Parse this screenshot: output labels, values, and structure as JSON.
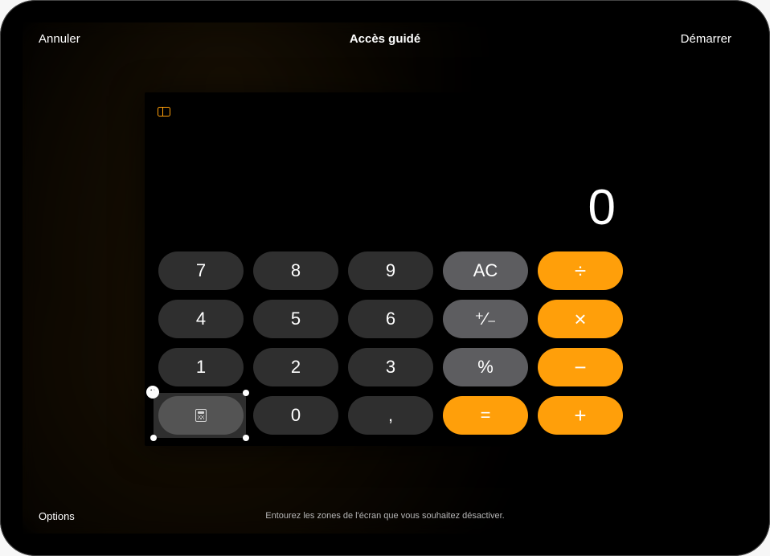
{
  "header": {
    "cancel": "Annuler",
    "title": "Accès guidé",
    "start": "Démarrer"
  },
  "footer": {
    "options": "Options",
    "hint": "Entourez les zones de l'écran que vous souhaitez désactiver."
  },
  "calculator": {
    "display": "0",
    "rows": [
      [
        {
          "id": "seven",
          "label": "7",
          "kind": "num"
        },
        {
          "id": "eight",
          "label": "8",
          "kind": "num"
        },
        {
          "id": "nine",
          "label": "9",
          "kind": "num"
        },
        {
          "id": "ac",
          "label": "AC",
          "kind": "fn"
        },
        {
          "id": "divide",
          "label": "÷",
          "kind": "op"
        }
      ],
      [
        {
          "id": "four",
          "label": "4",
          "kind": "num"
        },
        {
          "id": "five",
          "label": "5",
          "kind": "num"
        },
        {
          "id": "six",
          "label": "6",
          "kind": "num"
        },
        {
          "id": "sign",
          "label": "⁺∕₋",
          "kind": "fn"
        },
        {
          "id": "multiply",
          "label": "×",
          "kind": "op"
        }
      ],
      [
        {
          "id": "one",
          "label": "1",
          "kind": "num"
        },
        {
          "id": "two",
          "label": "2",
          "kind": "num"
        },
        {
          "id": "three",
          "label": "3",
          "kind": "num"
        },
        {
          "id": "percent",
          "label": "%",
          "kind": "fn"
        },
        {
          "id": "minus",
          "label": "−",
          "kind": "op"
        }
      ],
      [
        {
          "id": "mode",
          "label": "",
          "kind": "num",
          "icon": "calculator-icon"
        },
        {
          "id": "zero",
          "label": "0",
          "kind": "num"
        },
        {
          "id": "decimal",
          "label": ",",
          "kind": "num"
        },
        {
          "id": "equals",
          "label": "=",
          "kind": "eq"
        },
        {
          "id": "plus",
          "label": "+",
          "kind": "op"
        }
      ]
    ]
  },
  "masked_region": {
    "close_glyph": "×"
  },
  "colors": {
    "accent": "#ff9f0a"
  }
}
